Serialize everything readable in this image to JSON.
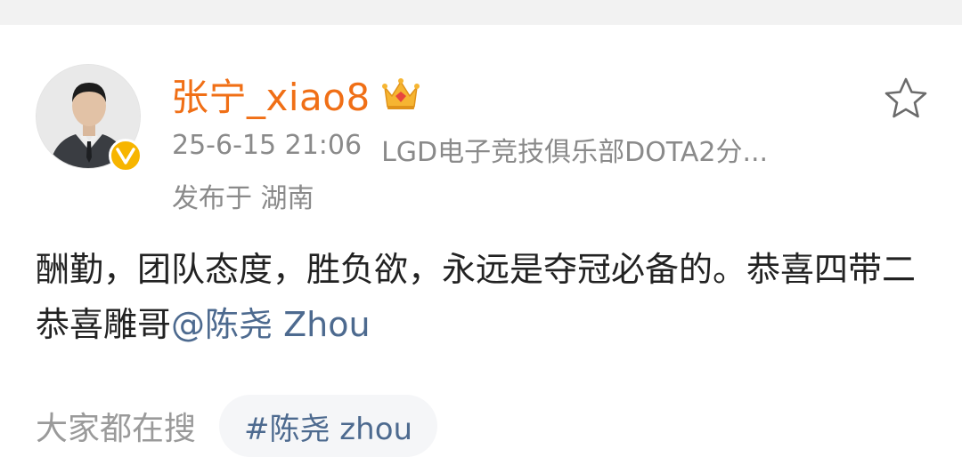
{
  "post": {
    "username": "张宁_xiao8",
    "time": "25-6-15 21:06",
    "source": "LGD电子竞技俱乐部DOTA2分...",
    "location": "发布于 湖南",
    "body_text": "酬勤，团队态度，胜负欲，永远是夺冠必备的。恭喜四带二恭喜雕哥",
    "mention": "@陈尧 Zhou"
  },
  "trending": {
    "label": "大家都在搜",
    "hashtag": "#陈尧 zhou"
  },
  "colors": {
    "username": "#f06f16",
    "link": "#4d6a8f",
    "meta": "#8a8a8a",
    "verified": "#f7b500"
  },
  "icons": [
    "avatar",
    "verified-badge-icon",
    "crown-icon",
    "star-icon"
  ]
}
